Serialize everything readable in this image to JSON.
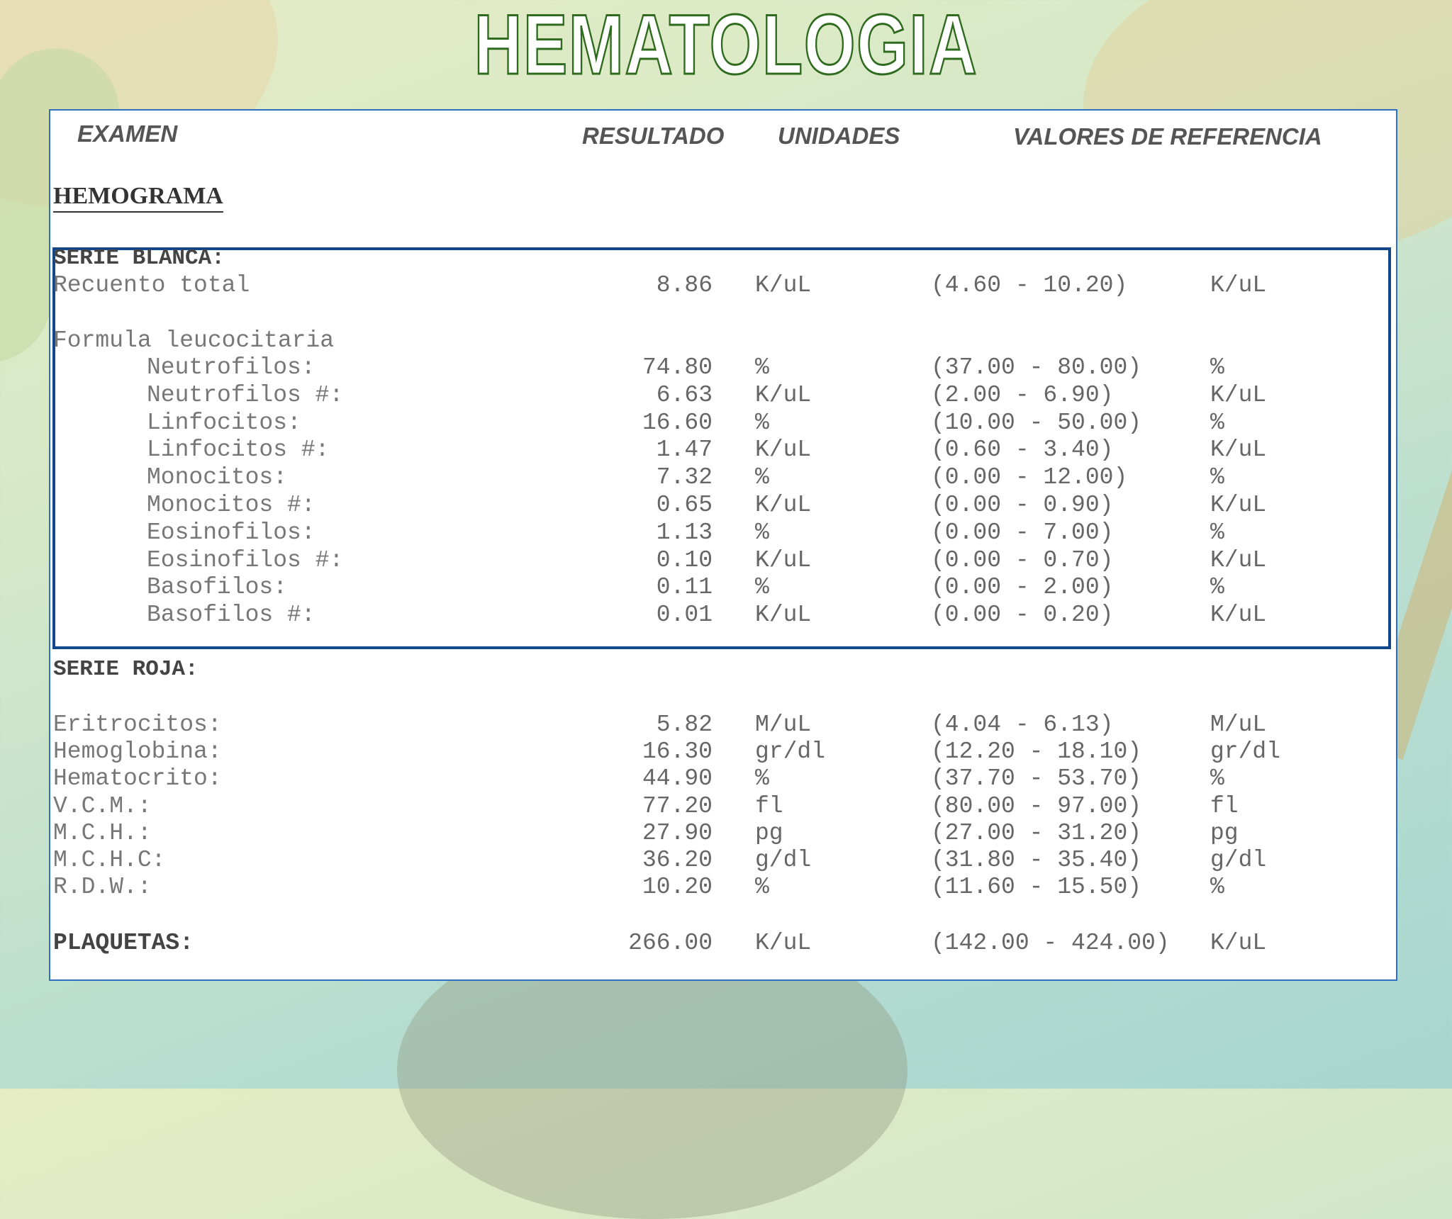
{
  "title": "HEMATOLOGIA",
  "headers": {
    "examen": "EXAMEN",
    "resultado": "RESULTADO",
    "unidades": "UNIDADES",
    "valores": "VALORES DE REFERENCIA"
  },
  "hemograma_label": "HEMOGRAMA",
  "serie_blanca": {
    "label": "SERIE BLANCA:",
    "recuento": {
      "name": "Recuento total",
      "value": "8.86",
      "unit": "K/uL",
      "ref": "(4.60 - 10.20)",
      "ref_unit": "K/uL"
    },
    "formula_label": "Formula leucocitaria",
    "rows": [
      {
        "name": "Neutrofilos:",
        "value": "74.80",
        "unit": "%",
        "ref": "(37.00 - 80.00)",
        "ref_unit": "%"
      },
      {
        "name": "Neutrofilos #:",
        "value": "6.63",
        "unit": "K/uL",
        "ref": "(2.00 - 6.90)",
        "ref_unit": "K/uL"
      },
      {
        "name": "Linfocitos:",
        "value": "16.60",
        "unit": "%",
        "ref": "(10.00 - 50.00)",
        "ref_unit": "%"
      },
      {
        "name": "Linfocitos #:",
        "value": "1.47",
        "unit": "K/uL",
        "ref": "(0.60 - 3.40)",
        "ref_unit": "K/uL"
      },
      {
        "name": "Monocitos:",
        "value": "7.32",
        "unit": "%",
        "ref": "(0.00 - 12.00)",
        "ref_unit": "%"
      },
      {
        "name": "Monocitos #:",
        "value": "0.65",
        "unit": "K/uL",
        "ref": "(0.00 - 0.90)",
        "ref_unit": "K/uL"
      },
      {
        "name": "Eosinofilos:",
        "value": "1.13",
        "unit": "%",
        "ref": "(0.00 - 7.00)",
        "ref_unit": "%"
      },
      {
        "name": "Eosinofilos #:",
        "value": "0.10",
        "unit": "K/uL",
        "ref": "(0.00 - 0.70)",
        "ref_unit": "K/uL"
      },
      {
        "name": "Basofilos:",
        "value": "0.11",
        "unit": "%",
        "ref": "(0.00 - 2.00)",
        "ref_unit": "%"
      },
      {
        "name": "Basofilos #:",
        "value": "0.01",
        "unit": "K/uL",
        "ref": "(0.00 - 0.20)",
        "ref_unit": "K/uL"
      }
    ]
  },
  "serie_roja": {
    "label": "SERIE ROJA:",
    "rows": [
      {
        "name": "Eritrocitos:",
        "value": "5.82",
        "unit": "M/uL",
        "ref": "(4.04 - 6.13)",
        "ref_unit": "M/uL"
      },
      {
        "name": "Hemoglobina:",
        "value": "16.30",
        "unit": "gr/dl",
        "ref": "(12.20 - 18.10)",
        "ref_unit": "gr/dl"
      },
      {
        "name": "Hematocrito:",
        "value": "44.90",
        "unit": "%",
        "ref": "(37.70 - 53.70)",
        "ref_unit": "%"
      },
      {
        "name": "V.C.M.:",
        "value": "77.20",
        "unit": "fl",
        "ref": "(80.00 - 97.00)",
        "ref_unit": "fl"
      },
      {
        "name": "M.C.H.:",
        "value": "27.90",
        "unit": "pg",
        "ref": "(27.00 - 31.20)",
        "ref_unit": "pg"
      },
      {
        "name": "M.C.H.C:",
        "value": "36.20",
        "unit": "g/dl",
        "ref": "(31.80 - 35.40)",
        "ref_unit": "g/dl"
      },
      {
        "name": "R.D.W.:",
        "value": "10.20",
        "unit": "%",
        "ref": "(11.60 - 15.50)",
        "ref_unit": "%"
      }
    ]
  },
  "plaquetas": {
    "name": "PLAQUETAS:",
    "value": "266.00",
    "unit": "K/uL",
    "ref": "(142.00 - 424.00)",
    "ref_unit": "K/uL"
  }
}
